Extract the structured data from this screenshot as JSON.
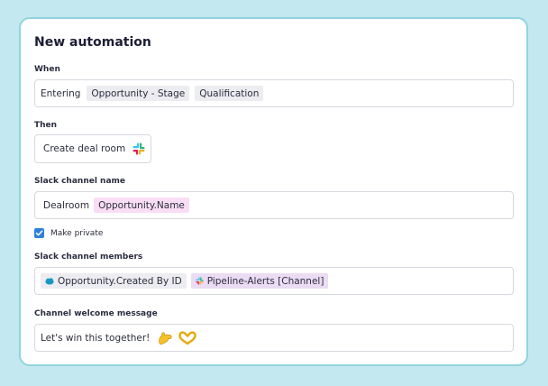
{
  "title": "New automation",
  "when": {
    "label": "When",
    "prefix": "Entering",
    "chips": [
      "Opportunity - Stage",
      "Qualification"
    ]
  },
  "then": {
    "label": "Then",
    "action": "Create deal room",
    "icon": "slack-icon"
  },
  "slack_channel_name": {
    "label": "Slack channel name",
    "prefix": "Dealroom",
    "chip": "Opportunity.Name"
  },
  "make_private": {
    "label": "Make private",
    "checked": true
  },
  "slack_channel_members": {
    "label": "Slack channel members",
    "chips": [
      {
        "text": "Opportunity.Created By ID",
        "icon": "salesforce-icon"
      },
      {
        "text": "Pipeline-Alerts [Channel]",
        "icon": "slack-icon"
      }
    ]
  },
  "welcome": {
    "label": "Channel welcome message",
    "text": "Let's win this together!",
    "emojis": [
      "flexed-biceps-emoji",
      "heart-hands-emoji"
    ]
  },
  "colors": {
    "background": "#c4e8ef",
    "card_border": "#8fd3e0",
    "checkbox": "#2f80d9",
    "chip_gray": "#ececf1",
    "chip_pink": "#f9ddf5",
    "chip_purple": "#ebdcf4"
  }
}
